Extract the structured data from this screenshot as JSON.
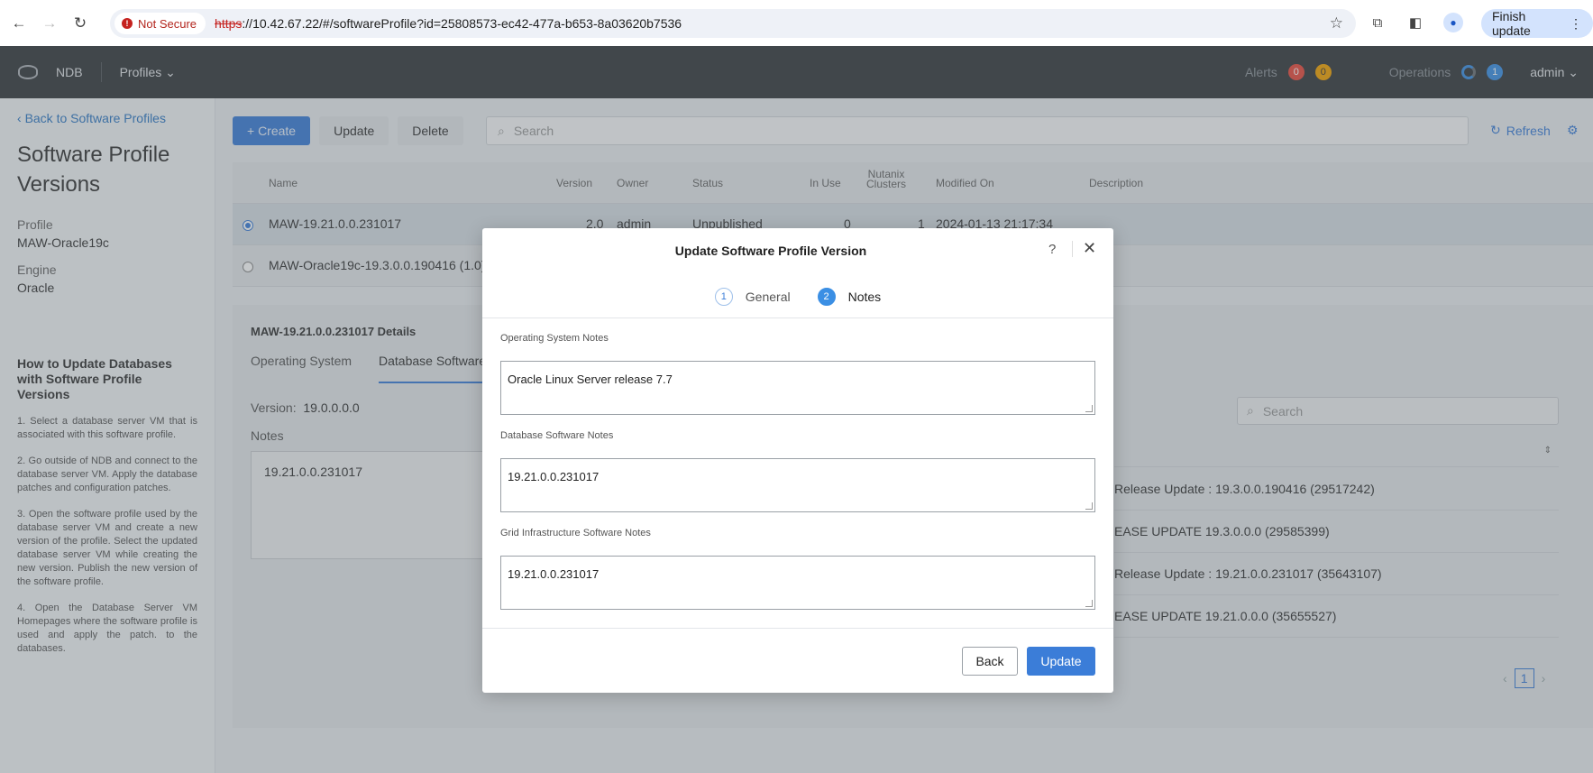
{
  "browser": {
    "security_label": "Not Secure",
    "url_protocol": "https",
    "url_rest": "://10.42.67.22/#/softwareProfile?id=25808573-ec42-477a-b653-8a03620b7536",
    "finish_update_label": "Finish update"
  },
  "header": {
    "app_name": "NDB",
    "profiles_menu": "Profiles",
    "alerts_label": "Alerts",
    "alerts_critical": "0",
    "alerts_warning": "0",
    "operations_label": "Operations",
    "operations_count": "1",
    "user": "admin"
  },
  "sidebar": {
    "back_link": "Back to Software Profiles",
    "title": "Software Profile Versions",
    "profile_label": "Profile",
    "profile_value": "MAW-Oracle19c",
    "engine_label": "Engine",
    "engine_value": "Oracle",
    "how_to_title": "How to Update Databases with Software Profile Versions",
    "steps": [
      "1. Select a database server VM that is associated with this software profile.",
      "2. Go outside of NDB and connect to the database server VM. Apply the database patches and configuration patches.",
      "3. Open the software profile used by the database server VM and create a new version of the profile. Select the updated database server VM while creating the new version. Publish the new version of the software profile.",
      "4. Open the Database Server VM Homepages where the software profile is used and apply the patch. to the databases."
    ]
  },
  "toolbar": {
    "create_label": "+ Create",
    "update_label": "Update",
    "delete_label": "Delete",
    "search_placeholder": "Search",
    "refresh_label": "Refresh"
  },
  "table": {
    "columns": [
      "Name",
      "Version",
      "Owner",
      "Status",
      "In Use",
      "Nutanix Clusters",
      "Modified On",
      "Description"
    ],
    "rows": [
      {
        "name": "MAW-19.21.0.0.231017",
        "version": "2.0",
        "owner": "admin",
        "status": "Unpublished",
        "in_use": "0",
        "clusters": "1",
        "modified": "2024-01-13 21:17:34"
      },
      {
        "name": "MAW-Oracle19c-19.3.0.0.190416 (1.0)"
      }
    ]
  },
  "details": {
    "title": "MAW-19.21.0.0.231017 Details",
    "tab_os": "Operating System",
    "tab_db": "Database Software",
    "version_label": "Version:",
    "version_value": "19.0.0.0.0",
    "notes_label": "Notes",
    "notes_value": "19.21.0.0.231017",
    "search_placeholder": "Search",
    "patches": [
      "Release Update : 19.3.0.0.190416 (29517242)",
      "EASE UPDATE 19.3.0.0.0 (29585399)",
      "Release Update : 19.21.0.0.231017 (35643107)",
      "EASE UPDATE 19.21.0.0.0 (35655527)"
    ],
    "page": "1"
  },
  "modal": {
    "title": "Update Software Profile Version",
    "help": "?",
    "close": "✕",
    "steps": [
      {
        "num": "1",
        "label": "General"
      },
      {
        "num": "2",
        "label": "Notes"
      }
    ],
    "os_notes_label": "Operating System Notes",
    "os_notes_value": "Oracle Linux Server release 7.7",
    "db_notes_label": "Database Software Notes",
    "db_notes_value": "19.21.0.0.231017",
    "grid_notes_label": "Grid Infrastructure Software Notes",
    "grid_notes_value": "19.21.0.0.231017",
    "back_label": "Back",
    "update_label": "Update"
  },
  "colors": {
    "accent": "#3b7dd8",
    "header_bg": "#35393d",
    "alert_red": "#e84b3c",
    "alert_amber": "#f2a100"
  }
}
